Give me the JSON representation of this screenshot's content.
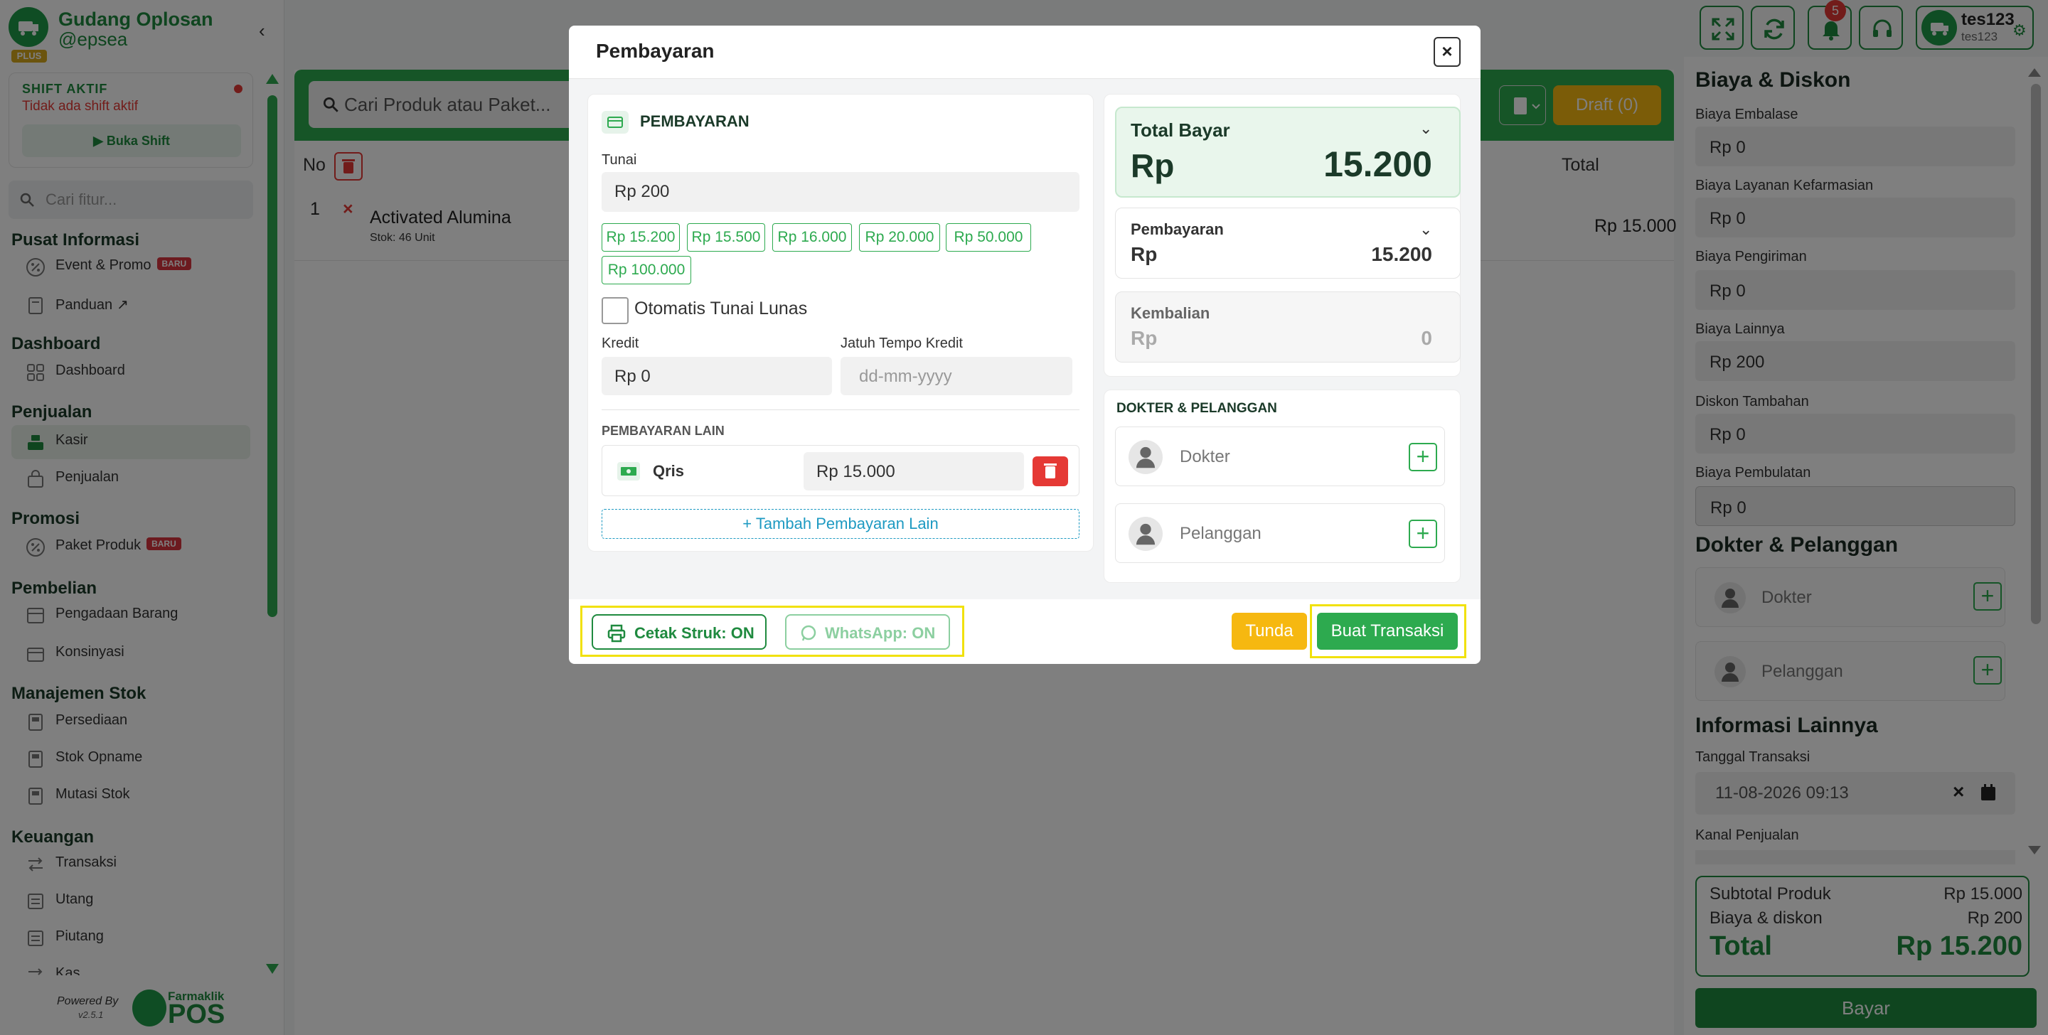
{
  "sidebar": {
    "brand_name": "Gudang Oplosan",
    "brand_handle": "@epsea",
    "plus_badge": "PLUS",
    "collapse_icon": "chevron-left-icon",
    "shift": {
      "title": "SHIFT AKTIF",
      "status": "Tidak ada shift aktif",
      "button": "Buka Shift"
    },
    "search_placeholder": "Cari fitur...",
    "new_badge": "BARU",
    "sections": [
      {
        "title": "Pusat Informasi",
        "items": [
          {
            "label": "Event & Promo",
            "icon": "percent-icon"
          },
          {
            "label": "Panduan",
            "icon": "book-icon"
          }
        ]
      },
      {
        "title": "Dashboard",
        "items": [
          {
            "label": "Dashboard",
            "icon": "grid-icon"
          }
        ]
      },
      {
        "title": "Penjualan",
        "items": [
          {
            "label": "Kasir",
            "icon": "cashier-icon"
          },
          {
            "label": "Penjualan",
            "icon": "bag-icon"
          }
        ]
      },
      {
        "title": "Promosi",
        "items": [
          {
            "label": "Paket Produk",
            "icon": "percent-icon"
          }
        ]
      },
      {
        "title": "Pembelian",
        "items": [
          {
            "label": "Pengadaan Barang",
            "icon": "truck-icon"
          },
          {
            "label": "Konsinyasi",
            "icon": "box-icon"
          }
        ]
      },
      {
        "title": "Manajemen Stok",
        "items": [
          {
            "label": "Persediaan",
            "icon": "clipboard-icon"
          },
          {
            "label": "Stok Opname",
            "icon": "clipboard-icon"
          },
          {
            "label": "Mutasi Stok",
            "icon": "clipboard-icon"
          }
        ]
      },
      {
        "title": "Keuangan",
        "items": [
          {
            "label": "Transaksi",
            "icon": "transfer-icon"
          },
          {
            "label": "Utang",
            "icon": "list-icon"
          },
          {
            "label": "Piutang",
            "icon": "list-icon"
          },
          {
            "label": "Kas",
            "icon": "wallet-icon"
          }
        ]
      }
    ],
    "active_item": "Kasir",
    "powered_by": "Powered By",
    "version": "v2.5.1",
    "pos_brand_small": "Farmaklik",
    "pos_brand_big": "POS"
  },
  "main": {
    "search_placeholder": "Cari Produk atau Paket...",
    "draft_label": "Draft (0)",
    "table_headers": {
      "no": "No",
      "total": "Total"
    },
    "rows": [
      {
        "no": "1",
        "name": "Activated Alumina",
        "stock": "Stok: 46 Unit",
        "total": "Rp 15.000"
      }
    ]
  },
  "topbar": {
    "notification_count": "5",
    "user_name": "tes123",
    "user_sub": "tes123"
  },
  "right_panel": {
    "biaya_title": "Biaya & Diskon",
    "fields": [
      {
        "label": "Biaya Embalase",
        "value": "Rp 0"
      },
      {
        "label": "Biaya Layanan Kefarmasian",
        "value": "Rp 0"
      },
      {
        "label": "Biaya Pengiriman",
        "value": "Rp 0"
      },
      {
        "label": "Biaya Lainnya",
        "value": "Rp 200"
      },
      {
        "label": "Diskon Tambahan",
        "value": "Rp 0"
      },
      {
        "label": "Biaya Pembulatan",
        "value": "Rp 0"
      }
    ],
    "dokter_title": "Dokter & Pelanggan",
    "dokter": "Dokter",
    "pelanggan": "Pelanggan",
    "info_title": "Informasi Lainnya",
    "tanggal_label": "Tanggal Transaksi",
    "tanggal_value": "11-08-2026  09:13",
    "kanal_label": "Kanal Penjualan",
    "summary": {
      "subtotal_label": "Subtotal Produk",
      "subtotal_value": "Rp 15.000",
      "biaya_label": "Biaya & diskon",
      "biaya_value": "Rp 200",
      "total_label": "Total",
      "total_value": "Rp 15.200"
    },
    "bayar": "Bayar"
  },
  "modal": {
    "title": "Pembayaran",
    "close": "×",
    "pembayaran_header": "PEMBAYARAN",
    "tunai_label": "Tunai",
    "tunai_value": "Rp 200",
    "quick_amounts": [
      "Rp 15.200",
      "Rp 15.500",
      "Rp 16.000",
      "Rp 20.000",
      "Rp 50.000",
      "Rp 100.000"
    ],
    "auto_lunas": "Otomatis Tunai Lunas",
    "kredit_label": "Kredit",
    "kredit_value": "Rp 0",
    "jatuh_tempo_label": "Jatuh Tempo Kredit",
    "jatuh_tempo_placeholder": "dd-mm-yyyy",
    "pembayaran_lain_header": "PEMBAYARAN LAIN",
    "pembayaran_lain": [
      {
        "method": "Qris",
        "value": "Rp 15.000"
      }
    ],
    "add_lain": "+ Tambah Pembayaran Lain",
    "total_bayar_label": "Total Bayar",
    "total_bayar_currency": "Rp",
    "total_bayar_value": "15.200",
    "pembayaran_label": "Pembayaran",
    "pembayaran_currency": "Rp",
    "pembayaran_value": "15.200",
    "kembalian_label": "Kembalian",
    "kembalian_currency": "Rp",
    "kembalian_value": "0",
    "dokter_pelanggan_header": "DOKTER & PELANGGAN",
    "dokter": "Dokter",
    "pelanggan": "Pelanggan",
    "cetak_struk": "Cetak Struk: ON",
    "whatsapp": "WhatsApp: ON",
    "tunda": "Tunda",
    "buat_transaksi": "Buat Transaksi"
  },
  "colors": {
    "primary": "#2daa4f",
    "primary_dark": "#1f8a3f",
    "warning": "#f6b810",
    "danger": "#e53935",
    "highlight": "#f1e10a"
  }
}
